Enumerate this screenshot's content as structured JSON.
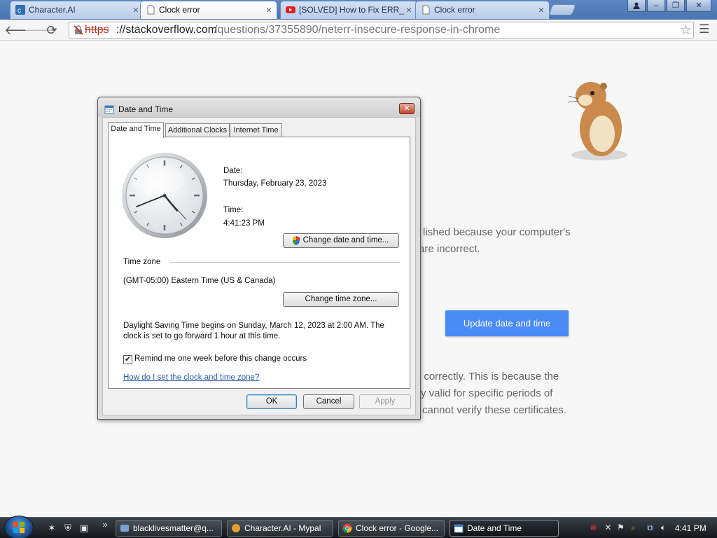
{
  "browser": {
    "tabs": [
      {
        "label": "Character.AI",
        "icon": "character-ai-icon"
      },
      {
        "label": "Clock error",
        "icon": "page-icon",
        "active": true
      },
      {
        "label": "[SOLVED] How to Fix ERR_",
        "icon": "youtube-icon"
      },
      {
        "label": "Clock error",
        "icon": "page-icon"
      }
    ],
    "close_glyph": "×",
    "window_controls": {
      "minimize": "–",
      "restore": "❐",
      "close": "✕"
    },
    "url": {
      "scheme": "https",
      "host": "://stackoverflow.com",
      "path": "/questions/37355890/neterr-insecure-response-in-chrome"
    }
  },
  "page": {
    "error_line_1": "lished because your computer's",
    "error_line_2": "are incorrect.",
    "update_button": "Update date and time",
    "detail_line_1": "t correctly. This is because the",
    "detail_line_2": "y valid for specific periods of",
    "detail_line_3": "cannot verify these certificates."
  },
  "dialog": {
    "title": "Date and Time",
    "tabs": [
      "Date and Time",
      "Additional Clocks",
      "Internet Time"
    ],
    "date_label": "Date:",
    "date_value": "Thursday, February 23, 2023",
    "time_label": "Time:",
    "time_value": "4:41:23 PM",
    "change_datetime_button": "Change date and time...",
    "timezone_heading": "Time zone",
    "timezone_value": "(GMT-05:00) Eastern Time (US & Canada)",
    "change_timezone_button": "Change time zone...",
    "dst_line_1": "Daylight Saving Time begins on Sunday, March 12, 2023 at 2:00 AM. The",
    "dst_line_2": "clock is set to go forward 1 hour at this time.",
    "remind_checkbox_label": "Remind me one week before this change occurs",
    "remind_checked": true,
    "check_glyph": "✔",
    "help_link": "How do I set the clock and time zone?",
    "ok_button": "OK",
    "cancel_button": "Cancel",
    "apply_button": "Apply",
    "clock_time": {
      "hour": 4,
      "minute": 41,
      "second": 23
    }
  },
  "taskbar": {
    "tasks": [
      {
        "label": "blacklivesmatter@q...",
        "icon": "messenger-icon"
      },
      {
        "label": "Character.AI - Mypal",
        "icon": "mypal-icon"
      },
      {
        "label": "Clock error - Google...",
        "icon": "chrome-icon"
      },
      {
        "label": "Date and Time",
        "icon": "date-time-icon",
        "active": true
      }
    ],
    "chevron": "»",
    "clock": "4:41 PM"
  },
  "colors": {
    "accent_blue": "#4a8af4",
    "insecure_red": "#c2382a",
    "link_blue": "#2a5db0"
  }
}
